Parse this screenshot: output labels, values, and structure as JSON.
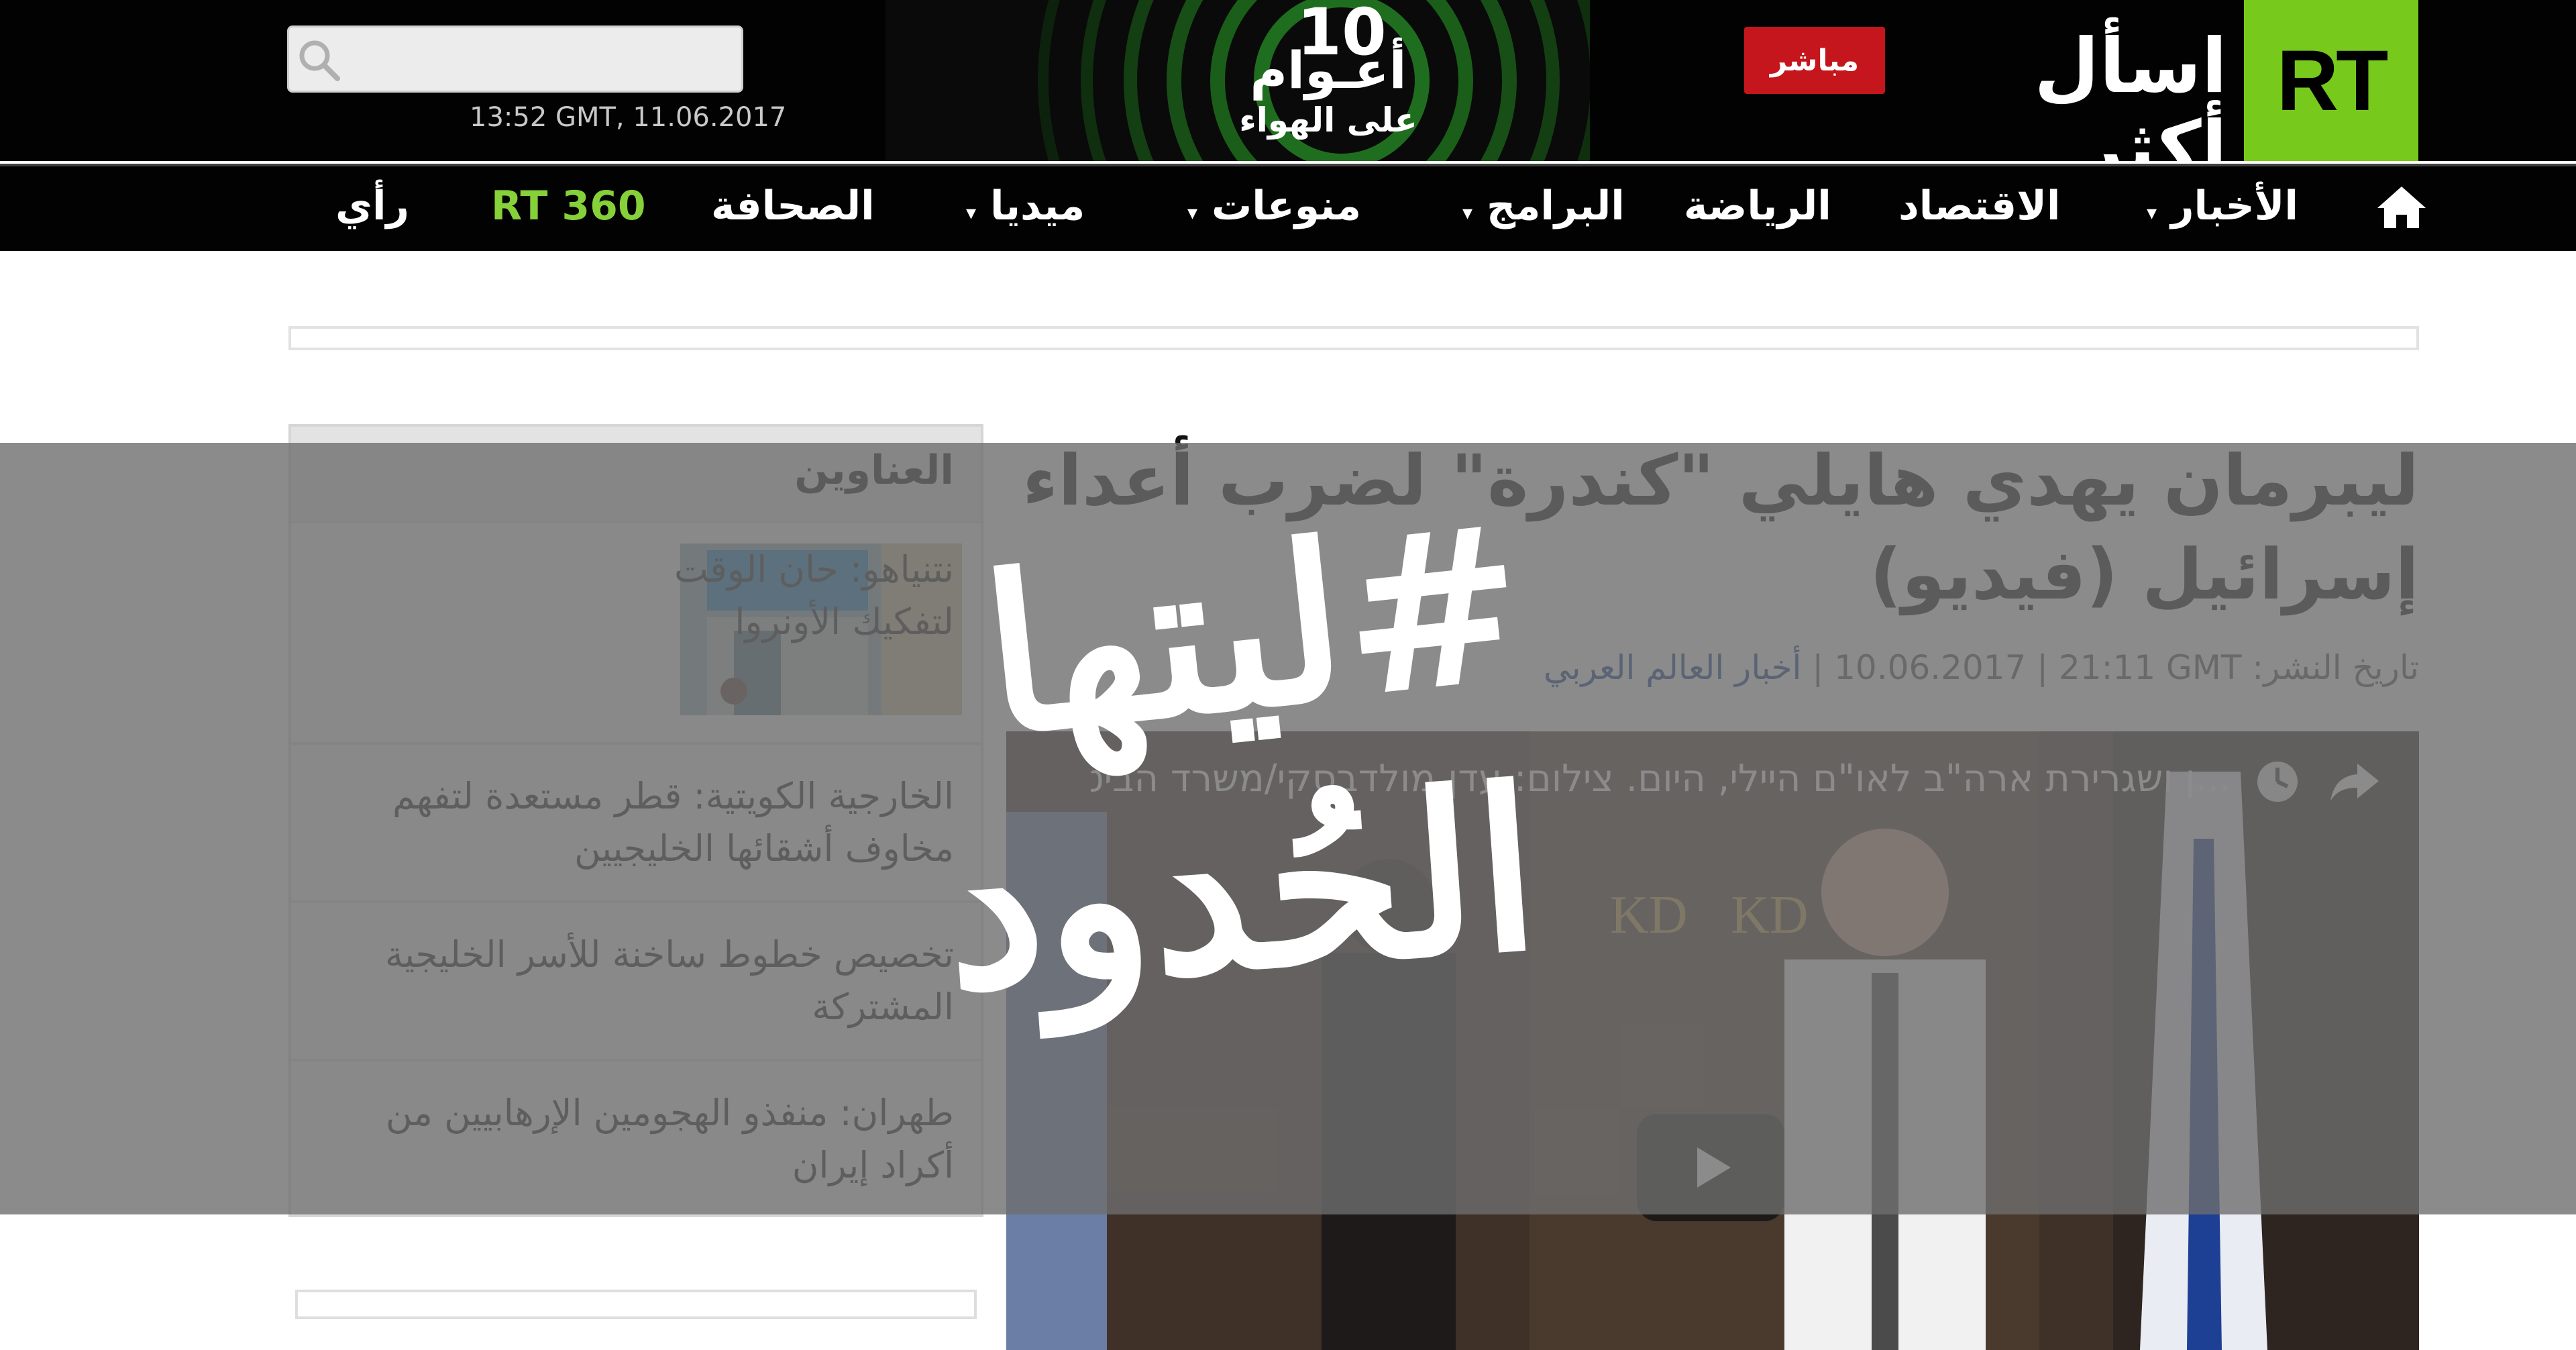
{
  "header": {
    "search_placeholder": "",
    "datetime": "13:52 GMT, 11.06.2017",
    "anniversary_number": "10",
    "anniversary_line1": "أعـوام",
    "anniversary_line2": "على الهواء",
    "live_label": "مباشر",
    "tagline": "اسأل أكثر",
    "logo": "RT"
  },
  "nav": {
    "items": [
      "الأخبار",
      "الاقتصاد",
      "الرياضة",
      "البرامج",
      "منوعات",
      "ميديا",
      "الصحافة",
      "RT 360",
      "رأي"
    ]
  },
  "sidebar": {
    "title": "العناوين",
    "items": [
      "نتنياهو: حان الوقت لتفكيك الأونروا",
      "الخارجية الكويتية: قطر مستعدة لتفهم مخاوف أشقائها الخليجيين",
      "تخصيص خطوط ساخنة للأسر الخليجية المشتركة",
      "طهران: منفذو الهجومين الإرهابيين من أكراد إيران"
    ]
  },
  "article": {
    "title": "ليبرمان يهدي هايلي \"كندرة\" لضرب أعداء إسرائيل (فيديو)",
    "published_label": "تاريخ النشر:",
    "published_date": "10.06.2017 | 21:11 GMT",
    "separator": "|",
    "category": "أخبار العالم العربي",
    "video_caption": "...ן ושגרירת ארה\"ב לאו\"ם היילי, היום. צילום: עדן מולדבסקי/משרד הביטחון"
  },
  "overlay": {
    "line1": "#ليتها",
    "line2": "الحُدود"
  },
  "colors": {
    "brand_green": "#77c91c",
    "live_red": "#c4161c",
    "nav_bg": "#020202",
    "link_blue": "#0f3f8c"
  }
}
